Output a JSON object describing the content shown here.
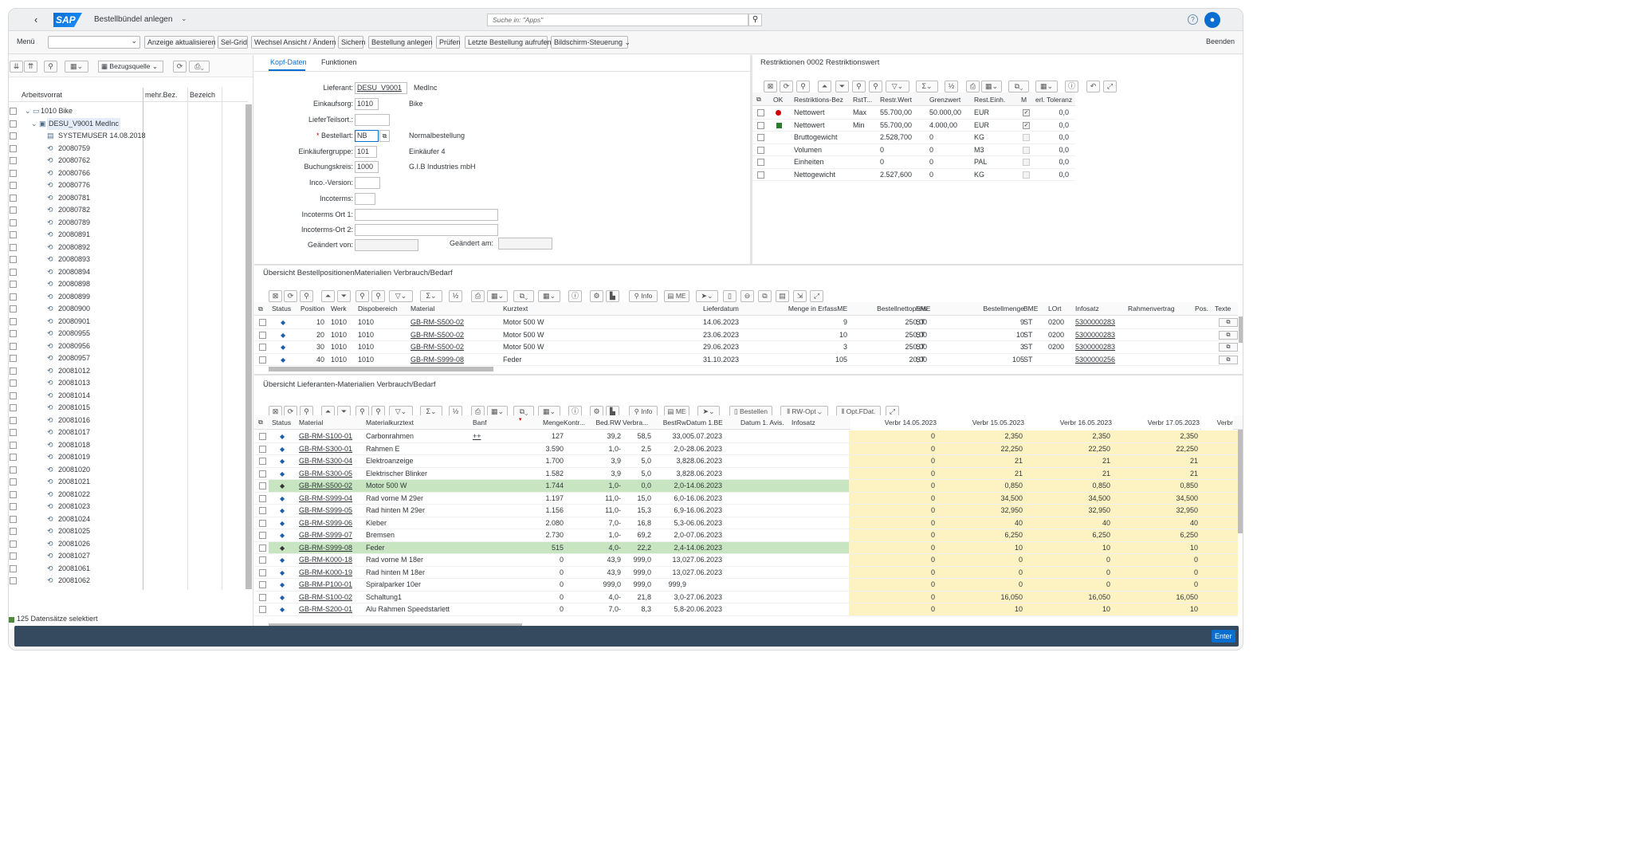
{
  "shell": {
    "title": "Bestellbündel anlegen",
    "search_placeholder": "Suche in: \"Apps\""
  },
  "toolbar": {
    "menu": "Menü",
    "buttons": [
      "Anzeige aktualisieren",
      "Sel-Grid",
      "Wechsel Ansicht / Ändern",
      "Sichern",
      "Bestellung anlegen",
      "Prüfen",
      "Letzte Bestellung aufrufen",
      "Bildschirm-Steuerung"
    ],
    "exit": "Beenden"
  },
  "tree": {
    "bezugsquelle": "Bezugsquelle",
    "col_headers": [
      "Arbeitsvorrat",
      "mehr.Bez.",
      "Bezeich"
    ],
    "items": [
      "1010 Bike",
      "DESU_V9001 MedInc",
      "SYSTEMUSER 14.08.2018",
      "20080759",
      "20080762",
      "20080766",
      "20080776",
      "20080781",
      "20080782",
      "20080789",
      "20080891",
      "20080892",
      "20080893",
      "20080894",
      "20080898",
      "20080899",
      "20080900",
      "20080901",
      "20080955",
      "20080956",
      "20080957",
      "20081012",
      "20081013",
      "20081014",
      "20081015",
      "20081016",
      "20081017",
      "20081018",
      "20081019",
      "20081020",
      "20081021",
      "20081022",
      "20081023",
      "20081024",
      "20081025",
      "20081026",
      "20081027",
      "20081061",
      "20081062"
    ],
    "status": "125 Datensätze selektiert"
  },
  "header": {
    "tabs": [
      "Kopf-Daten",
      "Funktionen"
    ],
    "fields": [
      {
        "label": "Lieferant:",
        "value": "DESU_V9001",
        "desc": "MedInc"
      },
      {
        "label": "Einkaufsorg:",
        "value": "1010",
        "desc": "Bike"
      },
      {
        "label": "LieferTeilsort.:",
        "value": "",
        "desc": ""
      },
      {
        "label": "Bestellart:",
        "value": "NB",
        "desc": "Normalbestellung"
      },
      {
        "label": "Einkäufergruppe:",
        "value": "101",
        "desc": "Einkäufer 4"
      },
      {
        "label": "Buchungskreis:",
        "value": "1000",
        "desc": "G.I.B Industries mbH"
      },
      {
        "label": "Inco.-Version:",
        "value": "",
        "desc": ""
      },
      {
        "label": "Incoterms:",
        "value": "",
        "desc": ""
      },
      {
        "label": "Incoterms Ort 1:",
        "value": "",
        "desc": ""
      },
      {
        "label": "Incoterms-Ort 2:",
        "value": "",
        "desc": ""
      },
      {
        "label": "Geändert von:",
        "value": "",
        "desc": ""
      }
    ],
    "changed_on": "Geändert am:"
  },
  "restr": {
    "title": "Restriktionen 0002 Restriktionswert",
    "cols": [
      "OK",
      "Restriktions-Bez",
      "RstT...",
      "Restr.Wert",
      "Grenzwert",
      "Rest.Einh.",
      "M",
      "erl. Toleranz"
    ],
    "rows": [
      {
        "ok": "red",
        "bez": "Nettowert",
        "typ": "Max",
        "wert": "55.700,00",
        "grenz": "50.000,00",
        "einh": "EUR",
        "m": true,
        "tol": "0,0"
      },
      {
        "ok": "green",
        "bez": "Nettowert",
        "typ": "Min",
        "wert": "55.700,00",
        "grenz": "4.000,00",
        "einh": "EUR",
        "m": true,
        "tol": "0,0"
      },
      {
        "ok": "",
        "bez": "Bruttogewicht",
        "typ": "",
        "wert": "2.528,700",
        "grenz": "0",
        "einh": "KG",
        "m": false,
        "tol": "0,0"
      },
      {
        "ok": "",
        "bez": "Volumen",
        "typ": "",
        "wert": "0",
        "grenz": "0",
        "einh": "M3",
        "m": false,
        "tol": "0,0"
      },
      {
        "ok": "",
        "bez": "Einheiten",
        "typ": "",
        "wert": "0",
        "grenz": "0",
        "einh": "PAL",
        "m": false,
        "tol": "0,0"
      },
      {
        "ok": "",
        "bez": "Nettogewicht",
        "typ": "",
        "wert": "2.527,600",
        "grenz": "0",
        "einh": "KG",
        "m": false,
        "tol": "0,0"
      }
    ]
  },
  "positions": {
    "title": "Übersicht BestellpositionenMaterialien Verbrauch/Bedarf",
    "btn_info": "Info",
    "btn_me": "ME",
    "cols": [
      "Status",
      "Position",
      "Werk",
      "Dispobereich",
      "Material",
      "Kurztext",
      "Lieferdatum",
      "Menge in ErfassME",
      "Bestellnettopreis",
      "EME",
      "Bestellmenge",
      "BME",
      "LOrt",
      "Infosatz",
      "Rahmenvertrag",
      "Pos.",
      "Texte"
    ],
    "rows": [
      [
        "10",
        "1010",
        "1010",
        "GB-RM-S500-02",
        "Motor 500 W",
        "14.06.2023",
        "9",
        "250,00",
        "ST",
        "9",
        "ST",
        "0200",
        "5300000283"
      ],
      [
        "20",
        "1010",
        "1010",
        "GB-RM-S500-02",
        "Motor 500 W",
        "23.06.2023",
        "10",
        "250,00",
        "ST",
        "10",
        "ST",
        "0200",
        "5300000283"
      ],
      [
        "30",
        "1010",
        "1010",
        "GB-RM-S500-02",
        "Motor 500 W",
        "29.06.2023",
        "3",
        "250,00",
        "ST",
        "3",
        "ST",
        "0200",
        "5300000283"
      ],
      [
        "40",
        "1010",
        "1010",
        "GB-RM-S999-08",
        "Feder",
        "31.10.2023",
        "105",
        "20,00",
        "ST",
        "105",
        "ST",
        "",
        "5300000256"
      ]
    ]
  },
  "vendor": {
    "title": "Übersicht Lieferanten-Materialien Verbrauch/Bedarf",
    "btn_info": "Info",
    "btn_me": "ME",
    "btn_order": "Bestellen",
    "btn_rw": "RW-Opt",
    "btn_opt": "Opt.FDat.",
    "cols": [
      "Status",
      "Material",
      "Materialkurztext",
      "Banf",
      "Menge",
      "Kontr...",
      "Bed.RW",
      "Verbra...",
      "BestRw",
      "Datum 1.BE",
      "Datum 1. Avis.",
      "Infosatz",
      "Verbr 14.05.2023",
      "Verbr 15.05.2023",
      "Verbr 16.05.2023",
      "Verbr 17.05.2023",
      "Verbr"
    ],
    "rows": [
      [
        "GB-RM-S100-01",
        "Carbonrahmen",
        "++",
        "127",
        "39,2",
        "58,5",
        "33,0",
        "05.07.2023",
        "0",
        "2,350",
        "2,350",
        "2,350",
        false
      ],
      [
        "GB-RM-S300-01",
        "Rahmen E",
        "",
        "3.590",
        "1,0-",
        "2,5",
        "2,0-",
        "28.06.2023",
        "0",
        "22,250",
        "22,250",
        "22,250",
        false
      ],
      [
        "GB-RM-S300-04",
        "Elektroanzeige",
        "",
        "1.700",
        "3,9",
        "5,0",
        "3,8",
        "28.06.2023",
        "0",
        "21",
        "21",
        "21",
        false
      ],
      [
        "GB-RM-S300-05",
        "Elektrischer Blinker",
        "",
        "1.582",
        "3,9",
        "5,0",
        "3,8",
        "28.06.2023",
        "0",
        "21",
        "21",
        "21",
        false
      ],
      [
        "GB-RM-S500-02",
        "Motor 500 W",
        "",
        "1.744",
        "1,0-",
        "0,0",
        "2,0-",
        "14.06.2023",
        "0",
        "0,850",
        "0,850",
        "0,850",
        true
      ],
      [
        "GB-RM-S999-04",
        "Rad vorne M 29er",
        "",
        "1.197",
        "11,0-",
        "15,0",
        "6,0-",
        "16.06.2023",
        "0",
        "34,500",
        "34,500",
        "34,500",
        false
      ],
      [
        "GB-RM-S999-05",
        "Rad hinten M 29er",
        "",
        "1.156",
        "11,0-",
        "15,3",
        "6,9-",
        "16.06.2023",
        "0",
        "32,950",
        "32,950",
        "32,950",
        false
      ],
      [
        "GB-RM-S999-06",
        "Kleber",
        "",
        "2.080",
        "7,0-",
        "16,8",
        "5,3-",
        "06.06.2023",
        "0",
        "40",
        "40",
        "40",
        false
      ],
      [
        "GB-RM-S999-07",
        "Bremsen",
        "",
        "2.730",
        "1,0-",
        "69,2",
        "2,0-",
        "07.06.2023",
        "0",
        "6,250",
        "6,250",
        "6,250",
        false
      ],
      [
        "GB-RM-S999-08",
        "Feder",
        "",
        "515",
        "4,0-",
        "22,2",
        "2,4-",
        "14.06.2023",
        "0",
        "10",
        "10",
        "10",
        true
      ],
      [
        "GB-RM-K000-18",
        "Rad vorne M 18er",
        "",
        "0",
        "43,9",
        "999,0",
        "13,0",
        "27.06.2023",
        "0",
        "0",
        "0",
        "0",
        false
      ],
      [
        "GB-RM-K000-19",
        "Rad hinten M 18er",
        "",
        "0",
        "43,9",
        "999,0",
        "13,0",
        "27.06.2023",
        "0",
        "0",
        "0",
        "0",
        false
      ],
      [
        "GB-RM-P100-01",
        "Spiralparker 10er",
        "",
        "0",
        "999,0",
        "999,0",
        "999,9",
        "",
        "0",
        "0",
        "0",
        "0",
        false
      ],
      [
        "GB-RM-S100-02",
        "Schaltung1",
        "",
        "0",
        "4,0-",
        "21,8",
        "3,0-",
        "27.06.2023",
        "0",
        "16,050",
        "16,050",
        "16,050",
        false
      ],
      [
        "GB-RM-S200-01",
        "Alu Rahmen Speedstarlett",
        "",
        "0",
        "7,0-",
        "8,3",
        "5,8-",
        "20.06.2023",
        "0",
        "10",
        "10",
        "10",
        false
      ]
    ]
  },
  "footer": {
    "enter": "Enter"
  },
  "colors": {
    "shell_bg": "#edeff0",
    "highlight_green": "#c6e5c0",
    "highlight_yellow": "#fdf3c2",
    "footer_bg": "#354a5f",
    "brand_blue": "#0a6ed1"
  }
}
